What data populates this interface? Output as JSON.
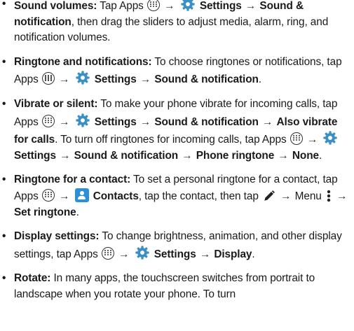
{
  "bullet": "•",
  "arrow": "→",
  "items": [
    {
      "title": "Sound volumes:",
      "t1": "Tap Apps",
      "settings": "Settings",
      "sound": "Sound & notification",
      "t2": ", then drag the sliders to adjust media, alarm, ring, and notification volumes."
    },
    {
      "title": "Ringtone and notifications:",
      "t1": "To choose ringtones or notifications, tap Apps",
      "settings": "Settings",
      "sound": "Sound & notification",
      "t2": "."
    },
    {
      "title": "Vibrate or silent:",
      "t1": "To make your phone vibrate for incoming calls, tap Apps",
      "settings": "Settings",
      "sound": "Sound & notification",
      "also": "Also vibrate for calls",
      "t2": ". To turn off ringtones for incoming calls, tap Apps",
      "settings2": "Settings",
      "sound2": "Sound & notification",
      "phone": "Phone ringtone",
      "none": "None",
      "t3": "."
    },
    {
      "title": "Ringtone for a contact:",
      "t1": "To set a personal ringtone for a contact, tap Apps",
      "contacts": "Contacts",
      "t2": ", tap the contact, then tap",
      "menu": "Menu",
      "set": "Set ringtone",
      "t3": "."
    },
    {
      "title": "Display settings:",
      "t1": "To change brightness, animation, and other display settings, tap Apps",
      "settings": "Settings",
      "display": "Display",
      "t2": "."
    },
    {
      "title": "Rotate:",
      "t1": "In many apps, the touchscreen switches from portrait to landscape when you rotate your phone. To turn"
    }
  ],
  "icons": {
    "apps": "apps-icon",
    "settings": "settings-gear-icon",
    "contacts": "contacts-icon",
    "edit": "pencil-edit-icon",
    "menu": "menu-more-icon"
  },
  "colors": {
    "text": "#1a1a1a",
    "gear": "#3a8fc4",
    "contacts": "#2b8fd9"
  }
}
